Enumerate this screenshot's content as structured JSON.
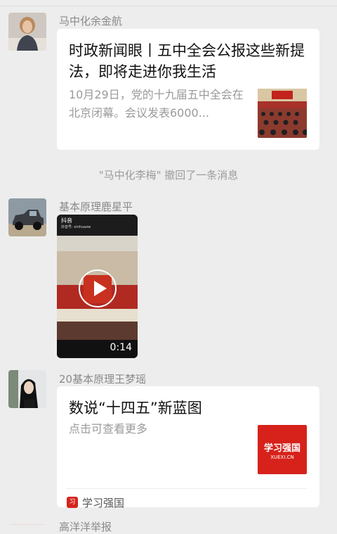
{
  "messages": [
    {
      "sender": "马中化余金航",
      "avatar_icon": "woman-portrait-avatar",
      "article": {
        "title": "时政新闻眼丨五中全会公报这些新提法，即将走进你我生活",
        "description": "10月29日，党的十九届五中全会在北京闭幕。会议发表6000...",
        "thumbnail": "meeting-hall-photo"
      }
    },
    {
      "sender": "基本原理鹿星平",
      "avatar_icon": "pickup-truck-avatar",
      "video": {
        "platform": "抖音",
        "account_id": "抖音号: xinhuaxw",
        "duration": "0:14"
      }
    },
    {
      "sender": "20基本原理王梦瑶",
      "avatar_icon": "girl-portrait-avatar",
      "article": {
        "title": "数说“十四五”新蓝图",
        "description": "点击可查看更多",
        "thumbnail": "xuexi-qiangguo-logo",
        "thumb_text": "学习强国",
        "thumb_sub": "XUEXI.CN",
        "source": "学习强国"
      }
    }
  ],
  "recall_notice": "\"马中化李梅\" 撤回了一条消息",
  "next_sender_partial": "高洋洋举报",
  "colors": {
    "background": "#ededed",
    "card": "#ffffff",
    "xuexi_red": "#d6221b"
  }
}
